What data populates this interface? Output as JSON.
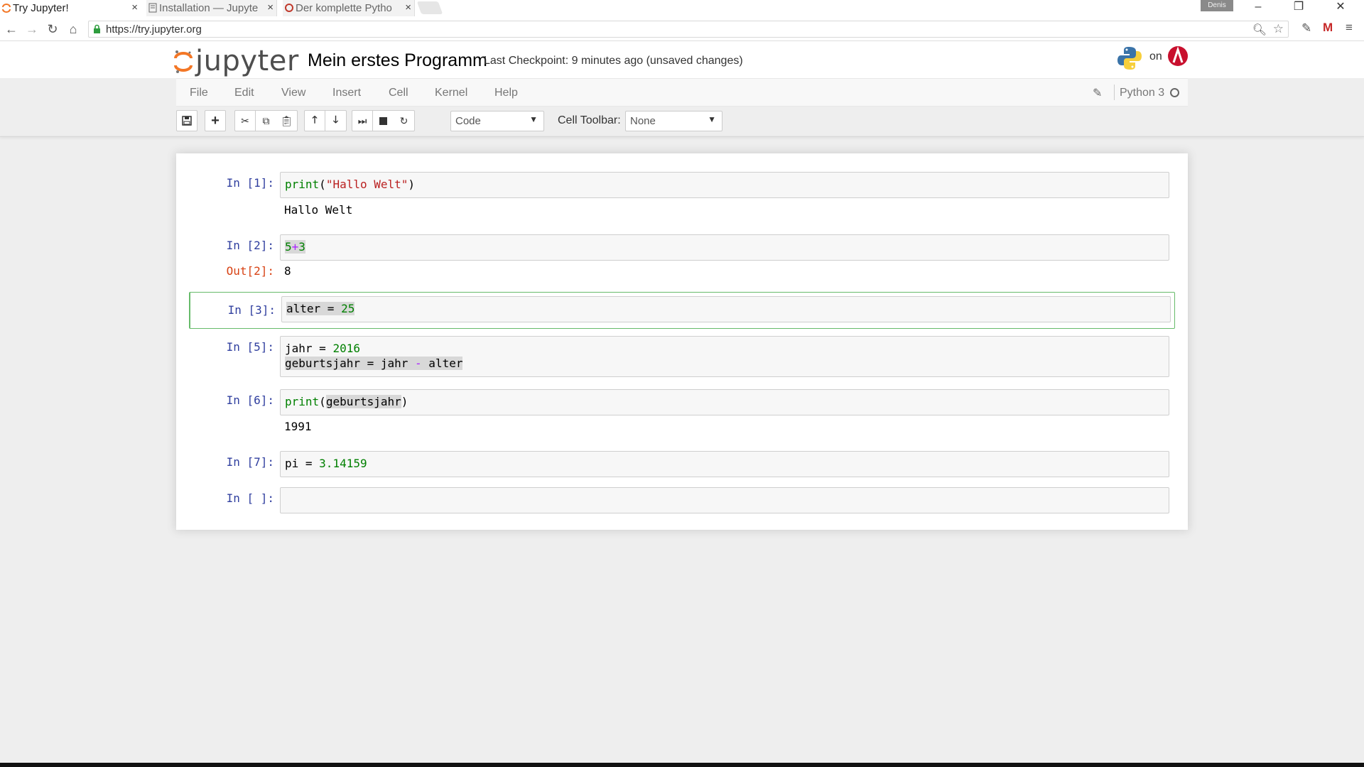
{
  "browser": {
    "tabs": [
      {
        "label": "Try Jupyter!",
        "active": true
      },
      {
        "label": "Installation — Jupyte",
        "active": false
      },
      {
        "label": "Der komplette Pytho",
        "active": false
      }
    ],
    "profile_name": "Denis",
    "url": "https://try.jupyter.org"
  },
  "header": {
    "logo_text": "jupyter",
    "notebook_title": "Mein erstes Programm",
    "checkpoint": "Last Checkpoint: 9 minutes ago (unsaved changes)",
    "on_text": "on"
  },
  "menu": {
    "items": [
      "File",
      "Edit",
      "View",
      "Insert",
      "Cell",
      "Kernel",
      "Help"
    ],
    "kernel_name": "Python 3"
  },
  "toolbar": {
    "cell_type": "Code",
    "cell_toolbar_label": "Cell Toolbar:",
    "cell_toolbar_value": "None"
  },
  "cells": [
    {
      "prompt": "In [1]:",
      "code": "print(\"Hallo Welt\")",
      "output": "Hallo Welt"
    },
    {
      "prompt": "In [2]:",
      "code": "5+3",
      "out_prompt": "Out[2]:",
      "output": "8"
    },
    {
      "prompt": "In [3]:",
      "code": "alter = 25",
      "selected": true
    },
    {
      "prompt": "In [5]:",
      "code": "jahr = 2016\ngeburtsjahr = jahr - alter"
    },
    {
      "prompt": "In [6]:",
      "code": "print(geburtsjahr)",
      "output": "1991"
    },
    {
      "prompt": "In [7]:",
      "code": "pi = 3.14159"
    },
    {
      "prompt": "In [ ]:",
      "code": ""
    }
  ],
  "colors": {
    "prompt_in": "#303f9f",
    "prompt_out": "#d84315",
    "selected_border": "#66bb6a",
    "keyword_green": "#008000",
    "string_red": "#ba2121"
  }
}
